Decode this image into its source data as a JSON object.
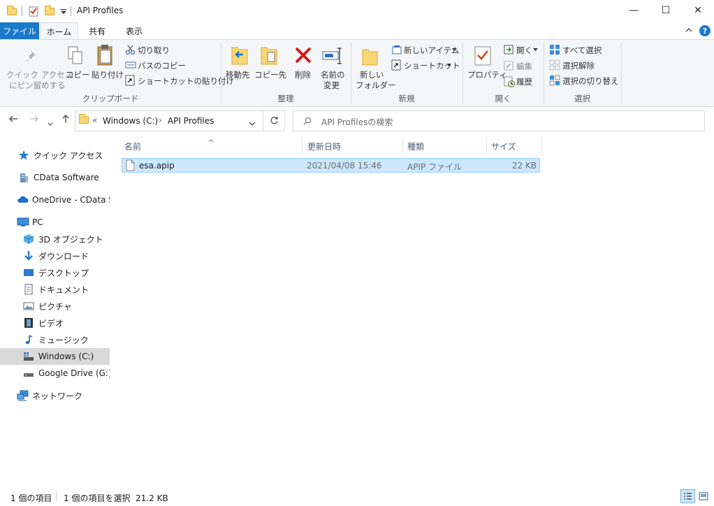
{
  "window": {
    "title": "API Profiles",
    "minimize_glyph": "—",
    "maximize_glyph": "☐",
    "close_glyph": "✕"
  },
  "ribbon_tabs": [
    {
      "label": "ファイル"
    },
    {
      "label": "ホーム"
    },
    {
      "label": "共有"
    },
    {
      "label": "表示"
    }
  ],
  "help_glyph": "?",
  "ribbon": {
    "clipboard": {
      "pin_label_1": "クイック アクセス",
      "pin_label_2": "にピン留めする",
      "copy": "コピー",
      "paste": "貼り付け",
      "cut": "切り取り",
      "copy_path": "パスのコピー",
      "paste_shortcut": "ショートカットの貼り付け",
      "group": "クリップボード"
    },
    "organize": {
      "move_to": "移動先",
      "copy_to": "コピー先",
      "delete": "削除",
      "rename_1": "名前の",
      "rename_2": "変更",
      "group": "整理"
    },
    "new": {
      "new_folder_1": "新しい",
      "new_folder_2": "フォルダー",
      "new_item": "新しいアイテム",
      "shortcut": "ショートカット",
      "group": "新規"
    },
    "open": {
      "properties": "プロパティ",
      "open": "開く",
      "edit": "編集",
      "history": "履歴",
      "group": "開く"
    },
    "select": {
      "select_all": "すべて選択",
      "select_none": "選択解除",
      "invert": "選択の切り替え",
      "group": "選択"
    }
  },
  "address": {
    "breadcrumb_prefix": "«",
    "crumb_1": "Windows (C:)",
    "crumb_sep": "›",
    "crumb_2": "API Profiles",
    "search_placeholder": "API Profilesの検索"
  },
  "nav": {
    "quick_access": "クイック アクセス",
    "cdata": "CData Software",
    "onedrive": "OneDrive - CData Sof",
    "pc": "PC",
    "objects3d": "3D オブジェクト",
    "downloads": "ダウンロード",
    "desktop": "デスクトップ",
    "documents": "ドキュメント",
    "pictures": "ピクチャ",
    "videos": "ビデオ",
    "music": "ミュージック",
    "windows_c": "Windows (C:)",
    "google_drive": "Google Drive (G:)",
    "network": "ネットワーク"
  },
  "columns": {
    "name": "名前",
    "modified": "更新日時",
    "type": "種類",
    "size": "サイズ"
  },
  "files": [
    {
      "name": "esa.apip",
      "modified": "2021/04/08 15:46",
      "type": "APIP ファイル",
      "size": "22 KB"
    }
  ],
  "status": {
    "item_count": "1 個の項目",
    "selected": "1 個の項目を選択  21.2 KB"
  },
  "colors": {
    "accent": "#1979ca",
    "selection": "#cce8ff",
    "folder": "#f8d775"
  }
}
